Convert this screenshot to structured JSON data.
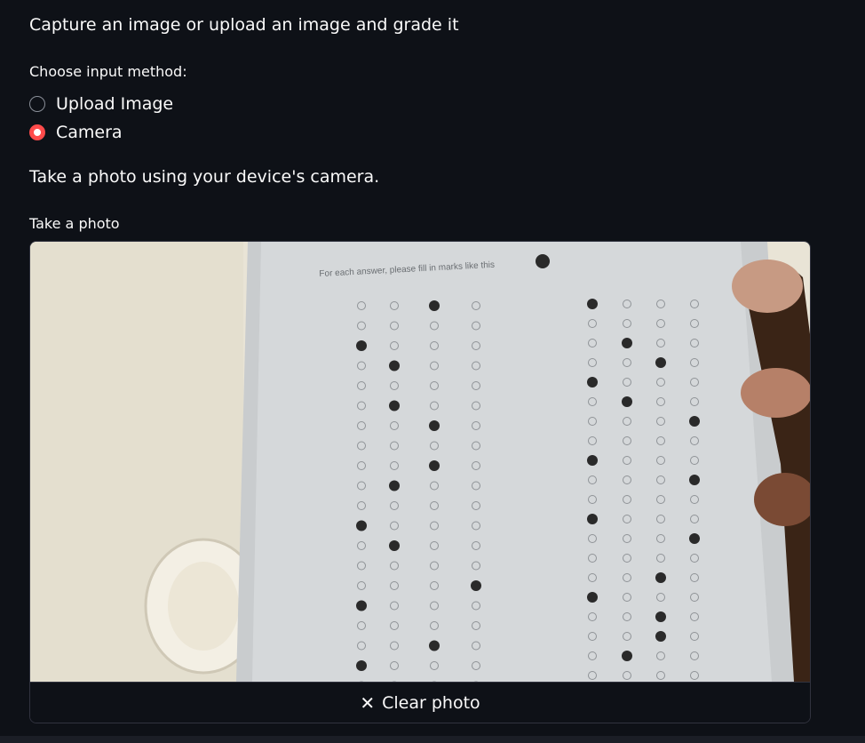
{
  "header": {
    "intro": "Capture an image or upload an image and grade it"
  },
  "input_method": {
    "label": "Choose input method:",
    "options": [
      {
        "label": "Upload Image",
        "selected": false
      },
      {
        "label": "Camera",
        "selected": true
      }
    ]
  },
  "camera": {
    "instructions": "Take a photo using your device's camera.",
    "label": "Take a photo",
    "clear_label": "Clear photo",
    "clear_icon": "x-icon",
    "sheet_header": "For each answer, please fill in marks like this"
  },
  "colors": {
    "accent": "#ff4b4b",
    "background": "#0e1117"
  }
}
